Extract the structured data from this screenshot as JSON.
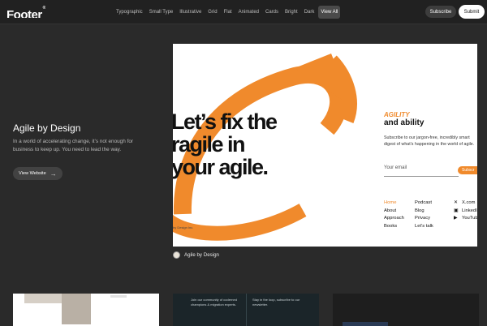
{
  "header": {
    "logo": "Footer",
    "logo_mark": "®",
    "nav": [
      "Typographic",
      "Small Type",
      "Illustrative",
      "Grid",
      "Flat",
      "Animated",
      "Cards",
      "Bright",
      "Dark",
      "View All"
    ],
    "nav_active": "View All",
    "subscribe_label": "Subscribe",
    "submit_label": "Submit"
  },
  "feature": {
    "title": "Agile by Design",
    "description": "In a world of accelerating change, it’s not enough for business to keep up. You need to lead the way.",
    "view_label": "View Website",
    "caption": "Agile by Design"
  },
  "preview": {
    "headline": [
      "Let’s fix the",
      "ragile in",
      "your agile."
    ],
    "copyright": "by Design Inc.",
    "agility": "AGILITY",
    "and_ability": "and ability",
    "subtext": "Subscribe to our jargon-free, incredibly smart digest of what’s happening in the world of agile.",
    "email_placeholder": "Your email",
    "email_button": "Subscr",
    "links_col1": [
      "Home",
      "About",
      "Approach",
      "Books"
    ],
    "links_col2": [
      "Podcast",
      "Blog",
      "Privacy",
      "Let’s talk"
    ],
    "links_col3": [
      "X.com",
      "LinkedI",
      "YouTub"
    ],
    "accent_color": "#f08a2c"
  },
  "thumbs": {
    "t2_left": "Join our community of coderned champions & migration experts.",
    "t2_right": "Stay in the loop, subscribe to our newsletter."
  }
}
